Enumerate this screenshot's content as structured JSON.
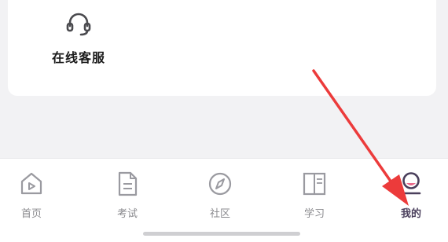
{
  "services": {
    "online_support": {
      "label": "在线客服",
      "icon": "headset-icon"
    }
  },
  "tabbar": {
    "tabs": [
      {
        "label": "首页",
        "icon": "home-icon",
        "active": false
      },
      {
        "label": "考试",
        "icon": "document-icon",
        "active": false
      },
      {
        "label": "社区",
        "icon": "compass-icon",
        "active": false
      },
      {
        "label": "学习",
        "icon": "book-icon",
        "active": false
      },
      {
        "label": "我的",
        "icon": "profile-icon",
        "active": true
      }
    ]
  },
  "annotation": {
    "type": "red-arrow",
    "color": "#ec3b3b",
    "target": "tab-mine"
  },
  "colors": {
    "active": "#4a3f5c",
    "inactive": "#8a8a8e",
    "accent_pink": "#e96a8c",
    "arrow": "#ec3b3b"
  }
}
